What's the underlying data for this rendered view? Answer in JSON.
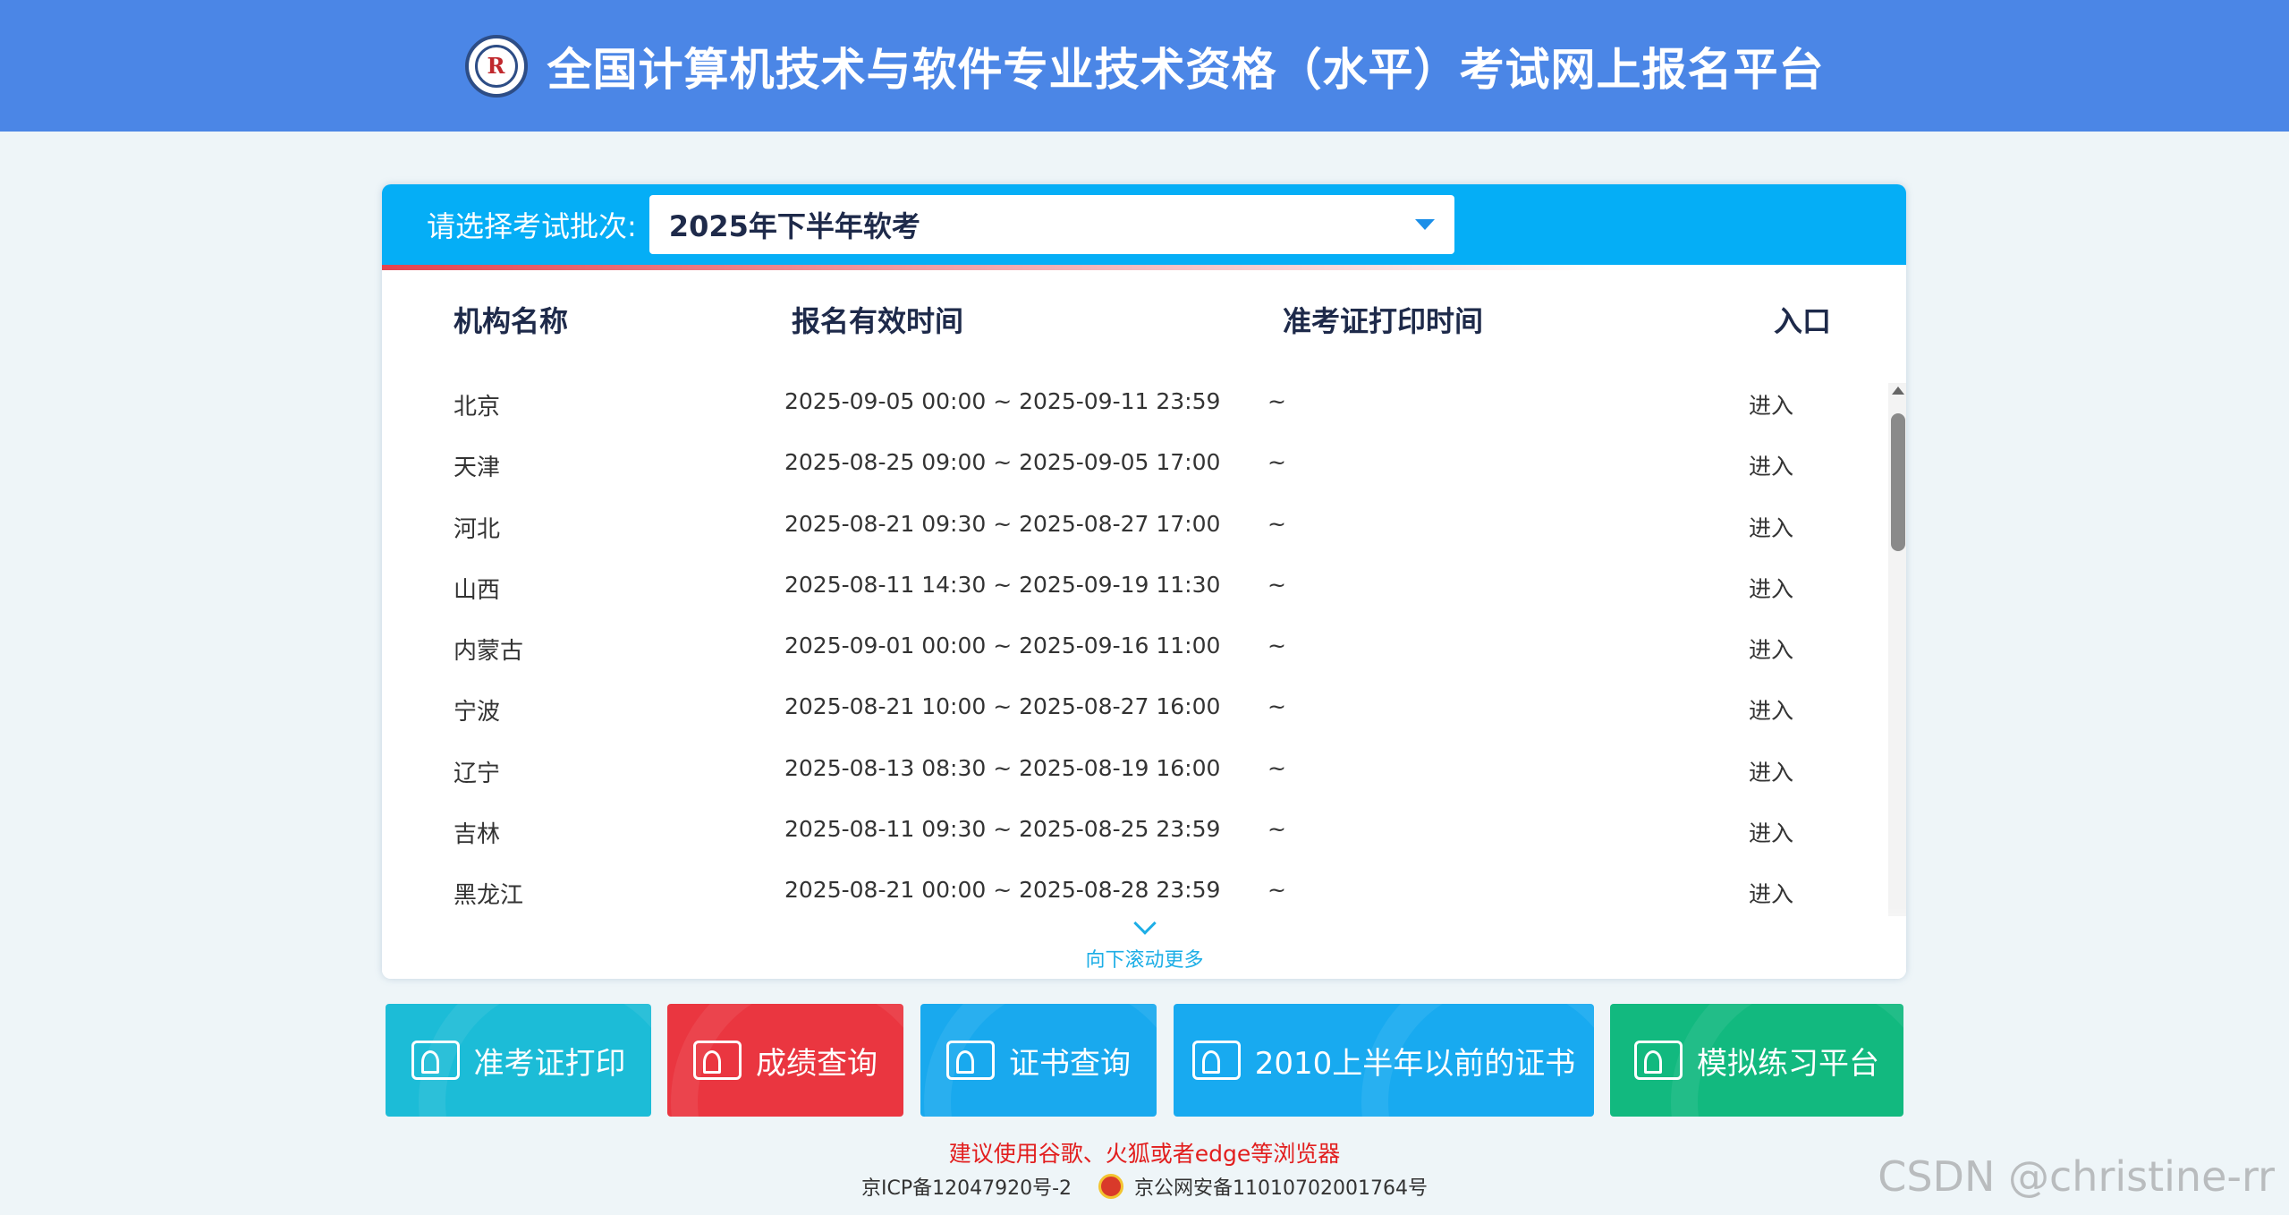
{
  "header": {
    "title": "全国计算机技术与软件专业技术资格（水平）考试网上报名平台",
    "logo_text": "R"
  },
  "batch": {
    "label": "请选择考试批次:",
    "selected": "2025年下半年软考"
  },
  "columns": [
    "机构名称",
    "报名有效时间",
    "准考证打印时间",
    "入口"
  ],
  "rows": [
    {
      "name": "北京",
      "reg": "2025-09-05 00:00 ~ 2025-09-11 23:59",
      "print": "~",
      "entry": "进入"
    },
    {
      "name": "天津",
      "reg": "2025-08-25 09:00 ~ 2025-09-05 17:00",
      "print": "~",
      "entry": "进入"
    },
    {
      "name": "河北",
      "reg": "2025-08-21 09:30 ~ 2025-08-27 17:00",
      "print": "~",
      "entry": "进入"
    },
    {
      "name": "山西",
      "reg": "2025-08-11 14:30 ~ 2025-09-19 11:30",
      "print": "~",
      "entry": "进入"
    },
    {
      "name": "内蒙古",
      "reg": "2025-09-01 00:00 ~ 2025-09-16 11:00",
      "print": "~",
      "entry": "进入"
    },
    {
      "name": "宁波",
      "reg": "2025-08-21 10:00 ~ 2025-08-27 16:00",
      "print": "~",
      "entry": "进入"
    },
    {
      "name": "辽宁",
      "reg": "2025-08-13 08:30 ~ 2025-08-19 16:00",
      "print": "~",
      "entry": "进入"
    },
    {
      "name": "吉林",
      "reg": "2025-08-11 09:30 ~ 2025-08-25 23:59",
      "print": "~",
      "entry": "进入"
    },
    {
      "name": "黑龙江",
      "reg": "2025-08-21 00:00 ~ 2025-08-28 23:59",
      "print": "~",
      "entry": "进入"
    }
  ],
  "scroll_more": "向下滚动更多",
  "buttons": {
    "admission": "准考证打印",
    "score": "成绩查询",
    "certificate": "证书查询",
    "old_certificate": "2010上半年以前的证书",
    "practice": "模拟练习平台"
  },
  "notice": "建议使用谷歌、火狐或者edge等浏览器",
  "footer": {
    "icp": "京ICP备12047920号-2",
    "police": "京公网安备11010702001764号"
  },
  "watermark": "CSDN @christine-rr",
  "colors": {
    "header": "#4b86e6",
    "panel_head": "#05aef6",
    "red": "#ea3640",
    "green": "#12b97f"
  }
}
